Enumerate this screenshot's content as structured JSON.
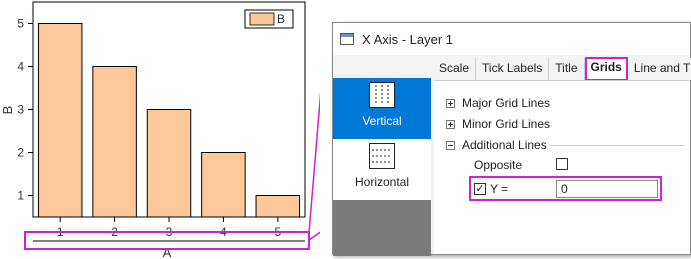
{
  "chart_data": {
    "type": "bar",
    "categories": [
      "1",
      "2",
      "3",
      "4",
      "5"
    ],
    "values": [
      5,
      4,
      3,
      2,
      1
    ],
    "xlabel": "A",
    "ylabel": "B",
    "ylim": [
      0.5,
      5.5
    ],
    "yticks": [
      "1",
      "2",
      "3",
      "4",
      "5"
    ],
    "legend": [
      "B"
    ],
    "legend_position": "top-right",
    "bar_color": "#fcc89a",
    "grid": false
  },
  "dialog": {
    "title": "X Axis - Layer 1",
    "tabs": [
      "Scale",
      "Tick Labels",
      "Title",
      "Grids",
      "Line and T"
    ],
    "active_tab": "Grids",
    "left_items": [
      {
        "label": "Vertical",
        "selected": true
      },
      {
        "label": "Horizontal",
        "selected": false
      }
    ],
    "tree": {
      "major": "Major Grid Lines",
      "minor": "Minor Grid Lines",
      "additional": "Additional Lines",
      "opposite": "Opposite",
      "y_label": "Y =",
      "y_value": "0",
      "opposite_checked": false,
      "y_checked": true
    }
  },
  "highlight_color": "#d21fd2"
}
